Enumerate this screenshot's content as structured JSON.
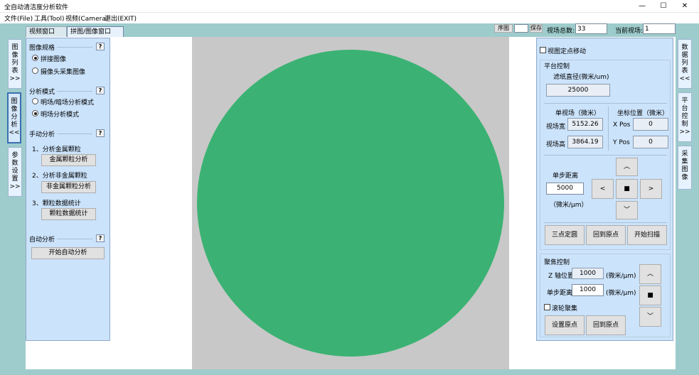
{
  "window": {
    "title": "全自动清洁度分析软件",
    "controls": {
      "minimize": "—",
      "maximize": "☐",
      "close": "✕"
    }
  },
  "menu": [
    "文件(File)",
    "工具(Tool)",
    "视频(Camera)",
    "退出(EXIT)"
  ],
  "tabs": [
    {
      "label": "视频窗口",
      "active": false
    },
    {
      "label": "拼图/图像窗口",
      "active": true
    }
  ],
  "topbar": {
    "btn1": "序图",
    "btn2": "保存",
    "total_fields_label": "视场总数:",
    "total_fields_value": "33",
    "current_field_label": "当前视场:",
    "current_field_value": "1"
  },
  "left_side_tabs": [
    {
      "label": "图像列表>>",
      "chars": [
        "图",
        "像",
        "列",
        "表",
        ">>"
      ]
    },
    {
      "label": "图像分析<<",
      "chars": [
        "图",
        "像",
        "分",
        "析",
        "<<"
      ]
    },
    {
      "label": "参数设置>>",
      "chars": [
        "参",
        "数",
        "设",
        "置",
        ">>"
      ]
    }
  ],
  "right_side_tabs": [
    {
      "label": "数据列表<<",
      "chars": [
        "数",
        "据",
        "列",
        "表",
        "<<"
      ]
    },
    {
      "label": "平台控制>>",
      "chars": [
        "平",
        "台",
        "控",
        "制",
        ">>"
      ]
    },
    {
      "label": "采集图像",
      "chars": [
        "采",
        "集",
        "图",
        "像"
      ]
    }
  ],
  "left_panel": {
    "image_spec": {
      "title": "图像规格",
      "help": "?",
      "options": [
        {
          "label": "拼接图像",
          "selected": true
        },
        {
          "label": "摄像头采集图像",
          "selected": false
        }
      ]
    },
    "analysis_mode": {
      "title": "分析模式",
      "help": "?",
      "options": [
        {
          "label": "明场/暗场分析模式",
          "selected": false
        },
        {
          "label": "明场分析模式",
          "selected": true
        }
      ]
    },
    "manual": {
      "title": "手动分析",
      "help": "?",
      "step1": "1、分析金属颗粒",
      "btn1": "金属颗粒分析",
      "step2": "2、分析非金属颗粒",
      "btn2": "非金属颗粒分析",
      "step3": "3、颗粒数据统计",
      "btn3": "颗粒数据统计"
    },
    "auto": {
      "title": "自动分析",
      "help": "?",
      "btn": "开始自动分析"
    }
  },
  "right_panel": {
    "view_fixed_move": "视图定点移动",
    "platform": {
      "title": "平台控制",
      "filter_label": "滤纸直径(微米/um)",
      "filter_value": "25000",
      "single_field_title": "单视场（微米）",
      "coord_title": "坐标位置（微米）",
      "width_label": "视场宽",
      "width_value": "5152.26",
      "height_label": "视场高",
      "height_value": "3864.19",
      "xpos_label": "X Pos",
      "xpos_value": "0",
      "ypos_label": "Y Pos",
      "ypos_value": "0",
      "step_label": "单步距离",
      "step_value": "5000",
      "step_unit": "（微米/μm）",
      "arrows": {
        "up": "︿",
        "left": "<",
        "stop": "■",
        "right": ">",
        "down": "﹀"
      },
      "btn_three_point": "三点定圆",
      "btn_home": "回到原点",
      "btn_scan": "开始扫描"
    },
    "focus": {
      "title": "聚焦控制",
      "z_label": "Z 轴位置",
      "z_value": "1000",
      "z_unit": "(微米/μm)",
      "step_label": "单步距离",
      "step_value": "1000",
      "step_unit": "(微米/μm)",
      "wheel_label": "滚轮聚集",
      "arrows": {
        "up": "︿",
        "stop": "■",
        "down": "﹀"
      },
      "btn_set_origin": "设置原点",
      "btn_home": "回到原点"
    }
  },
  "colors": {
    "circle": "#3bb273",
    "client_bg": "#9ecccc",
    "panel_bg": "#cbe3fb"
  }
}
